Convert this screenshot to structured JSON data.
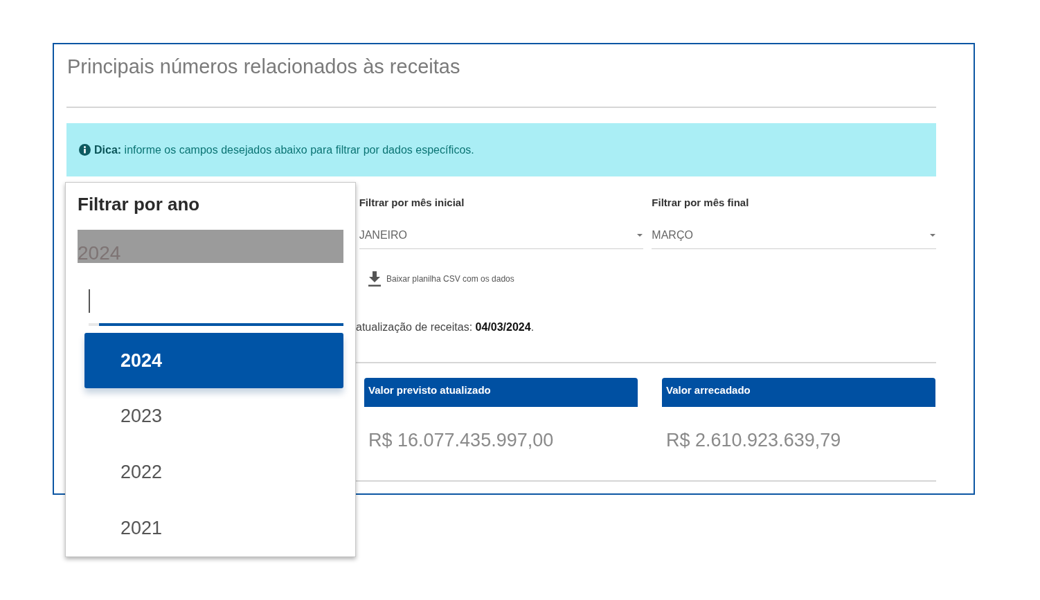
{
  "panel": {
    "title": "Principais números relacionados às receitas",
    "tip": "**Dica:** informe os campos desejados abaixo para filtrar por dados específicos.",
    "filters": [
      {
        "label": "Filtrar por mês inicial",
        "value": "JANEIRO"
      },
      {
        "label": "Filtrar por mês final",
        "value": "MARÇO"
      }
    ],
    "download_link": "Baixar planilha CSV com os dados",
    "update_note": "atualização de receitas: **04/03/2024**.",
    "cards": [
      {
        "title": "Valor previsto atualizado",
        "value": "R$ 16.077.435.997,00"
      },
      {
        "title": "Valor arrecadado",
        "value": "R$ 2.610.923.639,79"
      }
    ]
  },
  "year_dropdown": {
    "title": "Filtrar por ano",
    "current_value": "2024",
    "search": {
      "focused": true
    },
    "options": [
      {
        "label": "2024",
        "selected": true
      },
      {
        "label": "2023",
        "selected": false
      },
      {
        "label": "2022",
        "selected": false
      },
      {
        "label": "2021",
        "selected": false
      }
    ]
  }
}
